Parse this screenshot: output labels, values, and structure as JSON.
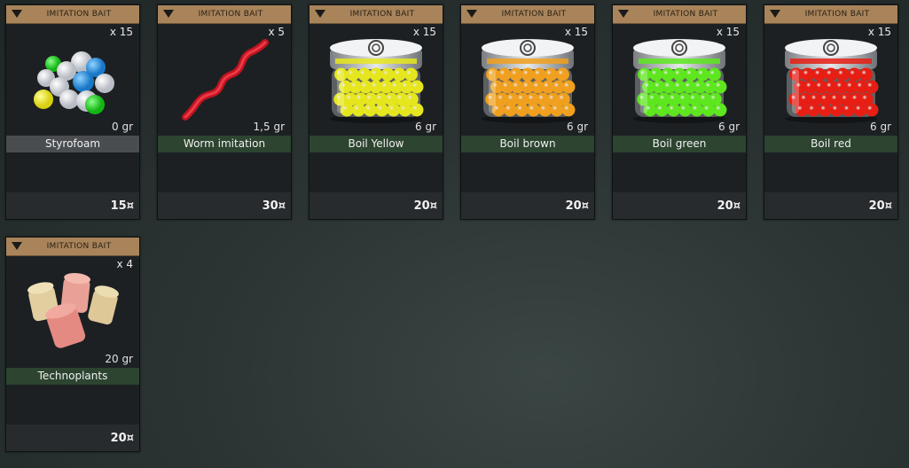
{
  "cards": [
    {
      "category": "IMITATION BAIT",
      "qty": "x 15",
      "weight": "0 gr",
      "name": "Styrofoam",
      "price": "15¤",
      "image": "multicolor-foam-balls"
    },
    {
      "category": "IMITATION BAIT",
      "qty": "x 5",
      "weight": "1,5 gr",
      "name": "Worm imitation",
      "price": "30¤",
      "image": "red-rubber-worm"
    },
    {
      "category": "IMITATION BAIT",
      "qty": "x 15",
      "weight": "6 gr",
      "name": "Boil Yellow",
      "price": "20¤",
      "image": "yellow-boilie-jar",
      "color": "#e6e61e"
    },
    {
      "category": "IMITATION BAIT",
      "qty": "x 15",
      "weight": "6 gr",
      "name": "Boil brown",
      "price": "20¤",
      "image": "orange-boilie-jar",
      "color": "#f0a01e"
    },
    {
      "category": "IMITATION BAIT",
      "qty": "x 15",
      "weight": "6 gr",
      "name": "Boil green",
      "price": "20¤",
      "image": "green-boilie-jar",
      "color": "#5ee61e"
    },
    {
      "category": "IMITATION BAIT",
      "qty": "x 15",
      "weight": "6 gr",
      "name": "Boil red",
      "price": "20¤",
      "image": "red-boilie-jar",
      "color": "#e61e14"
    },
    {
      "category": "IMITATION BAIT",
      "qty": "x 4",
      "weight": "20 gr",
      "name": "Technoplants",
      "price": "20¤",
      "image": "foam-plug-cylinders"
    }
  ],
  "colors": {
    "header": "#a9845a",
    "name_bar_selected": "#4a4d50",
    "name_bar": "#2c4430",
    "card_bg": "#1c2023"
  }
}
